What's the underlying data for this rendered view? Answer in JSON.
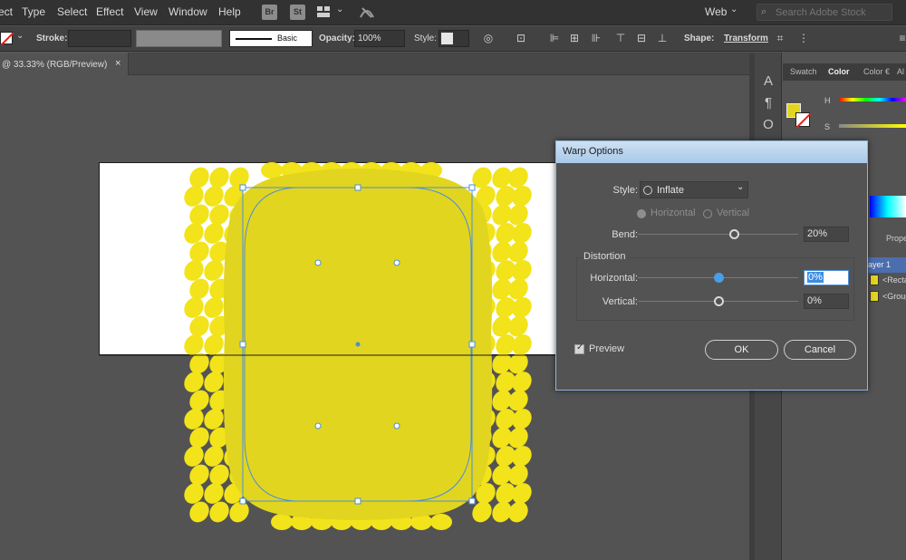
{
  "menu": {
    "items": [
      "ect",
      "Type",
      "Select",
      "Effect",
      "View",
      "Window",
      "Help"
    ],
    "bridge_badge": "Br",
    "stock_badge": "St",
    "workspace": "Web",
    "search_placeholder": "Search Adobe Stock"
  },
  "controls": {
    "stroke_label": "Stroke:",
    "brush_label": "Basic",
    "opacity_label": "Opacity:",
    "opacity_value": "100%",
    "style_label": "Style:",
    "shape_label": "Shape:",
    "transform_label": "Transform"
  },
  "document": {
    "tab_title": "@ 33.33% (RGB/Preview)",
    "close_glyph": "×"
  },
  "panels": {
    "collapse_glyph": "«",
    "tabs": [
      "Swatch",
      "Color",
      "Color €",
      "Al"
    ],
    "color_h_label": "H",
    "color_s_label": "S",
    "layers_tab": "Prope",
    "layer_name": "ayer 1",
    "layer_items": [
      "<Recta",
      "<Group"
    ]
  },
  "dialog": {
    "title": "Warp Options",
    "style_label": "Style:",
    "style_value": "Inflate",
    "orientation_options": [
      "Horizontal",
      "Vertical"
    ],
    "bend_label": "Bend:",
    "bend_value": "20%",
    "bend_level": 0.6,
    "distortion_label": "Distortion",
    "horizontal_label": "Horizontal:",
    "horizontal_value": "0%",
    "horizontal_level": 0.5,
    "vertical_label": "Vertical:",
    "vertical_value": "0%",
    "vertical_level": 0.5,
    "preview_label": "Preview",
    "ok_label": "OK",
    "cancel_label": "Cancel"
  },
  "colors": {
    "fill": "#e1d520",
    "pattern": "#f2e31a",
    "selection": "#4b8fd9",
    "dialog_title_bar": "#b7d2ec"
  }
}
